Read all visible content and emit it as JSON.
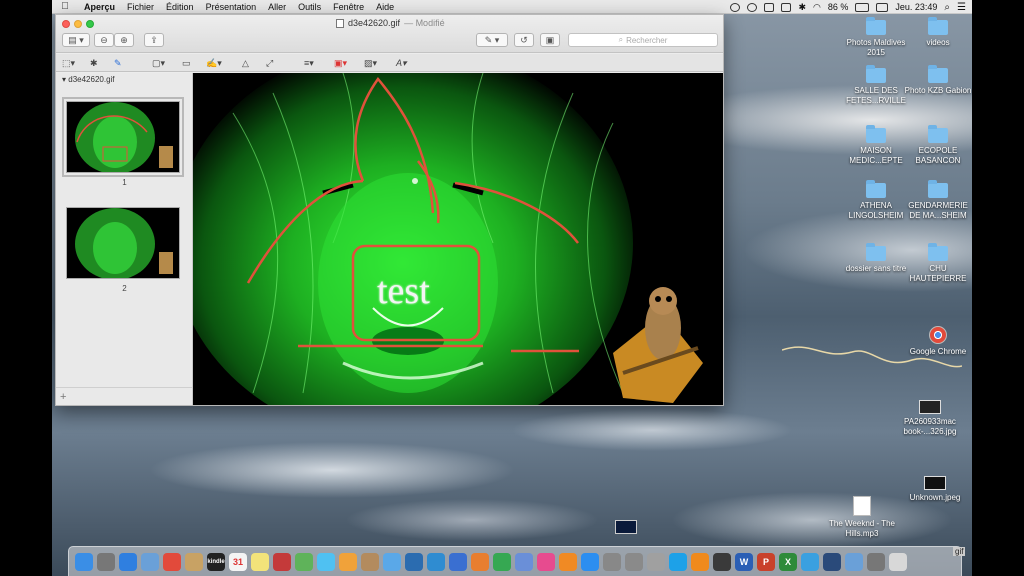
{
  "menubar": {
    "app_name": "Aperçu",
    "menus": [
      "Fichier",
      "Édition",
      "Présentation",
      "Aller",
      "Outils",
      "Fenêtre",
      "Aide"
    ],
    "battery": "86 %",
    "clock": "Jeu. 23:49"
  },
  "window": {
    "filename": "d3e42620.gif",
    "status": "— Modifié",
    "search_placeholder": "Rechercher",
    "sidebar_filename": "d3e42620.gif",
    "pages": [
      {
        "number": "1"
      },
      {
        "number": "2"
      }
    ],
    "canvas_text": "test",
    "add_label": "+"
  },
  "desktop": {
    "items": [
      {
        "label": "Photos Maldives 2015",
        "kind": "folder"
      },
      {
        "label": "videos",
        "kind": "folder"
      },
      {
        "label": "SALLE DES FETES...RVILLE",
        "kind": "folder"
      },
      {
        "label": "Photo KZB Gabion",
        "kind": "folder"
      },
      {
        "label": "MAISON MEDIC...EPTE",
        "kind": "folder"
      },
      {
        "label": "ECOPOLE BASANCON",
        "kind": "folder"
      },
      {
        "label": "ATHENA LINGOLSHEIM",
        "kind": "folder"
      },
      {
        "label": "GENDARMERIE DE MA...SHEIM",
        "kind": "folder"
      },
      {
        "label": "dossier sans titre",
        "kind": "folder"
      },
      {
        "label": "CHU HAUTEPIERRE",
        "kind": "folder"
      },
      {
        "label": "Google Chrome",
        "kind": "app"
      },
      {
        "label": "PA260933mac book-...326.jpg",
        "kind": "image"
      },
      {
        "label": "Unknown.jpeg",
        "kind": "image"
      },
      {
        "label": "The Weeknd - The Hills.mp3",
        "kind": "file"
      }
    ],
    "gif_tag": "gif"
  },
  "dock": {
    "apps": [
      {
        "name": "finder-icon",
        "color": "#3a8ee6"
      },
      {
        "name": "launchpad-icon",
        "color": "#777777"
      },
      {
        "name": "safari-icon",
        "color": "#2f7fe0"
      },
      {
        "name": "preview-icon",
        "color": "#6aa0d8"
      },
      {
        "name": "chrome-icon",
        "color": "#e24a3b"
      },
      {
        "name": "folder-icon",
        "color": "#c8a264"
      },
      {
        "name": "kindle-icon",
        "color": "#222222",
        "label": "kindle"
      },
      {
        "name": "calendar-icon",
        "color": "#f4f4f4",
        "label": "31"
      },
      {
        "name": "notes-icon",
        "color": "#f3e37a"
      },
      {
        "name": "photo-booth-icon",
        "color": "#c43a3a"
      },
      {
        "name": "maps-icon",
        "color": "#5fb35a"
      },
      {
        "name": "messages-icon",
        "color": "#4fc1f2"
      },
      {
        "name": "photos-icon",
        "color": "#f0a23a"
      },
      {
        "name": "contacts-icon",
        "color": "#b38b5e"
      },
      {
        "name": "mail-icon",
        "color": "#5aa8e8"
      },
      {
        "name": "earth-icon",
        "color": "#2b6cb0"
      },
      {
        "name": "sketchup-icon",
        "color": "#2f8cd1"
      },
      {
        "name": "keynote-icon",
        "color": "#3a6fd1"
      },
      {
        "name": "pages-icon",
        "color": "#e87e2f"
      },
      {
        "name": "numbers-icon",
        "color": "#36a852"
      },
      {
        "name": "podium-icon",
        "color": "#6a8fd8"
      },
      {
        "name": "itunes-icon",
        "color": "#e74b8f"
      },
      {
        "name": "ibooks-icon",
        "color": "#f08a24"
      },
      {
        "name": "app-store-icon",
        "color": "#2c8ef0"
      },
      {
        "name": "preview-doc-icon",
        "color": "#888888"
      },
      {
        "name": "settings-icon",
        "color": "#8a8a8a"
      },
      {
        "name": "automator-icon",
        "color": "#a0a0a0"
      },
      {
        "name": "skype-icon",
        "color": "#1da1e8"
      },
      {
        "name": "vlc-icon",
        "color": "#f08a1c"
      },
      {
        "name": "cloud-icon",
        "color": "#3a3a3a"
      },
      {
        "name": "word-icon",
        "color": "#2b5fb5",
        "label": "W"
      },
      {
        "name": "powerpoint-icon",
        "color": "#c9412b",
        "label": "P"
      },
      {
        "name": "excel-icon",
        "color": "#2e8b3a",
        "label": "X"
      },
      {
        "name": "chat-icon",
        "color": "#3aa0e0"
      },
      {
        "name": "quicktime-icon",
        "color": "#2a4a7a"
      },
      {
        "name": "screen-icon",
        "color": "#6aa0d8"
      },
      {
        "name": "downloads-icon",
        "color": "#777777"
      },
      {
        "name": "trash-icon",
        "color": "#d8d8d8"
      }
    ]
  }
}
